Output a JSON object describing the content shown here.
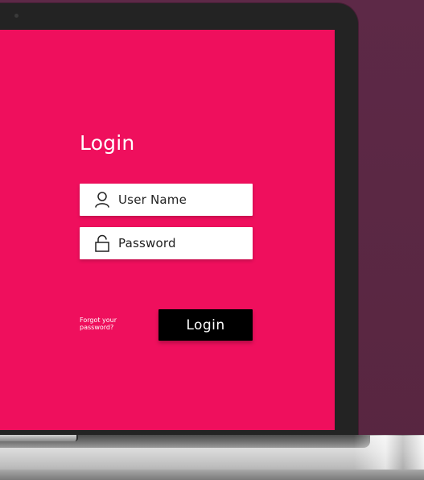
{
  "login_form": {
    "title": "Login",
    "username_placeholder": "User Name",
    "password_placeholder": "Password",
    "forgot_password": "Forgot your password?",
    "submit_label": "Login"
  },
  "icons": {
    "username_field": "user-icon",
    "password_field": "unlocked-padlock-icon",
    "camera": "camera-dot"
  },
  "colors": {
    "screen_background": "#ef0f5d",
    "page_background": "#5b2844",
    "button_background": "#000000",
    "field_background": "#ffffff",
    "laptop_bezel": "#232323"
  }
}
